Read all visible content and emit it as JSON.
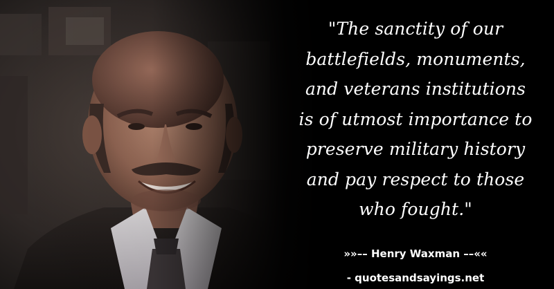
{
  "quote": {
    "lines": [
      "\"The sanctity of our",
      "battlefields, monuments,",
      "and veterans institutions",
      "is of utmost importance to",
      "preserve military history",
      "and pay respect to those",
      "who fought.\""
    ]
  },
  "attribution": {
    "prefix": "»»–– ",
    "author": "Henry Waxman",
    "suffix": " ––««"
  },
  "source": {
    "text": "- quotesandsayings.net"
  },
  "colors": {
    "background": "#000000",
    "text": "#ffffff"
  }
}
